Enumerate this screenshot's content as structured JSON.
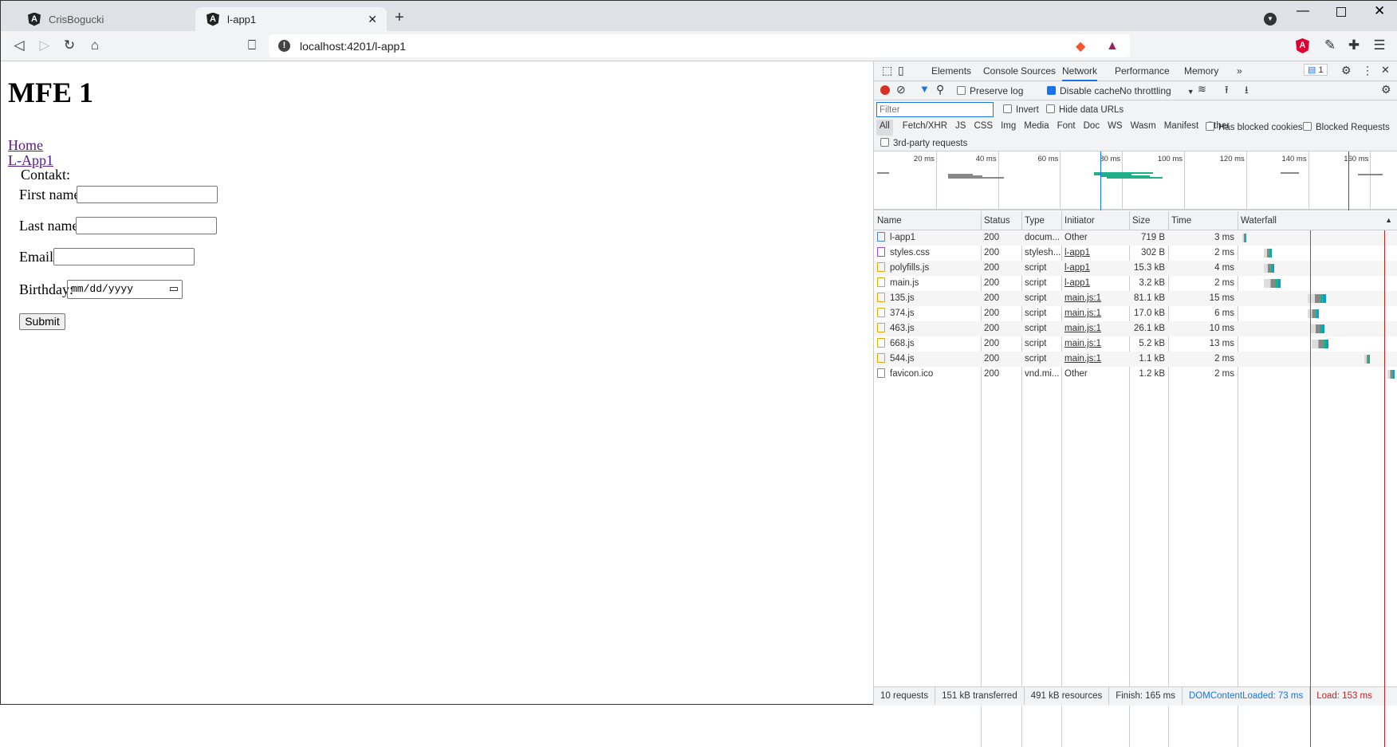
{
  "browser": {
    "tabs": [
      {
        "title": "CrisBogucki",
        "active": false
      },
      {
        "title": "l-app1",
        "active": true
      }
    ],
    "new_tab": "+",
    "url": "localhost:4201/l-app1",
    "window_controls": [
      "minimize",
      "maximize",
      "close"
    ]
  },
  "page": {
    "title": "MFE 1",
    "links": [
      "Home",
      "L-App1"
    ],
    "legend": "Contakt:",
    "fields": [
      {
        "label": "First name:",
        "value": ""
      },
      {
        "label": "Last name:",
        "value": ""
      },
      {
        "label": "Email:",
        "value": ""
      },
      {
        "label": "Birthday:",
        "placeholder": "mm/dd/yyyy"
      }
    ],
    "submit": "Submit"
  },
  "devtools": {
    "tabs": [
      "Elements",
      "Console",
      "Sources",
      "Network",
      "Performance",
      "Memory"
    ],
    "active_tab": "Network",
    "more": "»",
    "issues_badge": "1",
    "toolbar": {
      "preserve_log": "Preserve log",
      "preserve_checked": false,
      "disable_cache": "Disable cache",
      "disable_checked": true,
      "throttling": "No throttling"
    },
    "filter": {
      "placeholder": "Filter",
      "invert": "Invert",
      "hide_data": "Hide data URLs"
    },
    "types": [
      "All",
      "Fetch/XHR",
      "JS",
      "CSS",
      "Img",
      "Media",
      "Font",
      "Doc",
      "WS",
      "Wasm",
      "Manifest",
      "Other"
    ],
    "blocked_cookies": "Has blocked cookies",
    "blocked_requests": "Blocked Requests",
    "third_party": "3rd-party requests",
    "overview_ticks": [
      "20 ms",
      "40 ms",
      "60 ms",
      "80 ms",
      "100 ms",
      "120 ms",
      "140 ms",
      "160 ms"
    ],
    "columns": [
      "Name",
      "Status",
      "Type",
      "Initiator",
      "Size",
      "Time",
      "Waterfall"
    ],
    "rows": [
      {
        "name": "l-app1",
        "status": "200",
        "type": "docum...",
        "initiator": "Other",
        "size": "719 B",
        "time": "3 ms",
        "icon": "document-icon",
        "link": false,
        "wf": [
          1,
          5
        ]
      },
      {
        "name": "styles.css",
        "status": "200",
        "type": "stylesh...",
        "initiator": "l-app1",
        "size": "302 B",
        "time": "2 ms",
        "icon": "stylesheet-icon",
        "link": true,
        "wf": [
          24,
          32
        ]
      },
      {
        "name": "polyfills.js",
        "status": "200",
        "type": "script",
        "initiator": "l-app1",
        "size": "15.3 kB",
        "time": "4 ms",
        "icon": "script-icon",
        "link": true,
        "wf": [
          24,
          35
        ]
      },
      {
        "name": "main.js",
        "status": "200",
        "type": "script",
        "initiator": "l-app1",
        "size": "3.2 kB",
        "time": "2 ms",
        "icon": "script-icon",
        "link": true,
        "wf": [
          24,
          42
        ]
      },
      {
        "name": "135.js",
        "status": "200",
        "type": "script",
        "initiator": "main.js:1",
        "size": "81.1 kB",
        "time": "15 ms",
        "icon": "script-icon",
        "link": true,
        "wf": [
          71,
          90
        ]
      },
      {
        "name": "374.js",
        "status": "200",
        "type": "script",
        "initiator": "main.js:1",
        "size": "17.0 kB",
        "time": "6 ms",
        "icon": "script-icon",
        "link": true,
        "wf": [
          71,
          83
        ]
      },
      {
        "name": "463.js",
        "status": "200",
        "type": "script",
        "initiator": "main.js:1",
        "size": "26.1 kB",
        "time": "10 ms",
        "icon": "script-icon",
        "link": true,
        "wf": [
          73,
          89
        ]
      },
      {
        "name": "668.js",
        "status": "200",
        "type": "script",
        "initiator": "main.js:1",
        "size": "5.2 kB",
        "time": "13 ms",
        "icon": "script-icon",
        "link": true,
        "wf": [
          75,
          93
        ]
      },
      {
        "name": "544.js",
        "status": "200",
        "type": "script",
        "initiator": "main.js:1",
        "size": "1.1 kB",
        "time": "2 ms",
        "icon": "script-icon",
        "link": true,
        "wf": [
          131,
          137
        ]
      },
      {
        "name": "favicon.ico",
        "status": "200",
        "type": "vnd.mi...",
        "initiator": "Other",
        "size": "1.2 kB",
        "time": "2 ms",
        "icon": "file-icon",
        "link": false,
        "wf": [
          156,
          164
        ]
      }
    ],
    "dom_content_loaded_ms": 73,
    "load_ms": 153,
    "footer": [
      "10 requests",
      "151 kB transferred",
      "491 kB resources",
      "Finish: 165 ms",
      "DOMContentLoaded: 73 ms",
      "Load: 153 ms"
    ],
    "colors": {
      "dcl": "#1a73e8",
      "load": "#c5221f",
      "accent": "#1a73e8"
    }
  }
}
